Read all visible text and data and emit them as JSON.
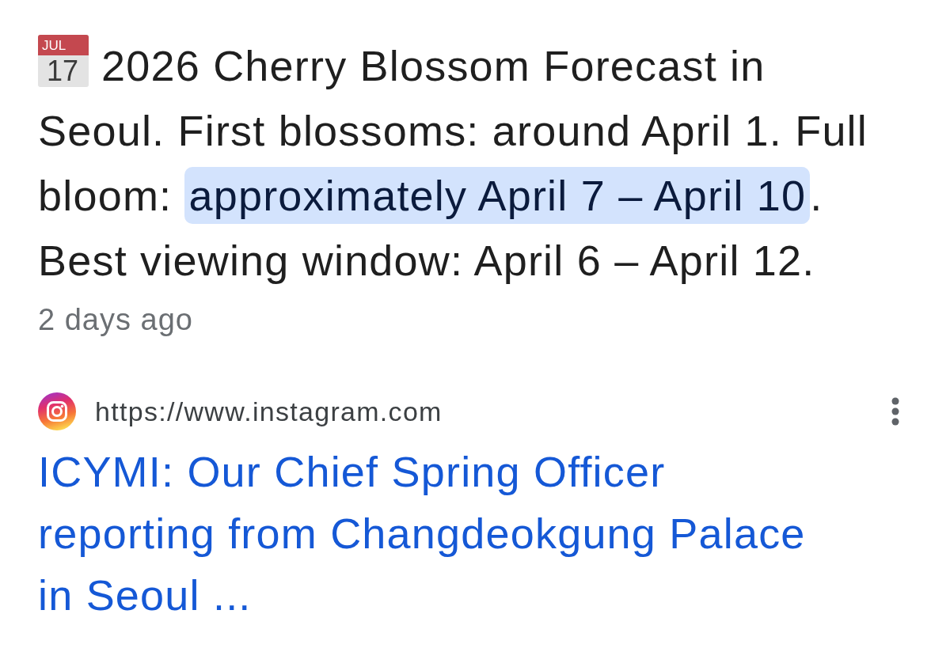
{
  "answer": {
    "calendar": {
      "month": "JUL",
      "day": "17"
    },
    "text": "2026 Cherry Blossom Forecast in Seoul. First blossoms: around April 1. Full bloom: **approximately April 7 – April 10**. Best viewing window: April 6 – April 12.",
    "age": "2 days ago"
  },
  "result": {
    "url": "https://www.instagram.com",
    "title": "ICYMI: Our Chief Spring Officer reporting from Changdeokgung Palace in Seoul ..."
  }
}
